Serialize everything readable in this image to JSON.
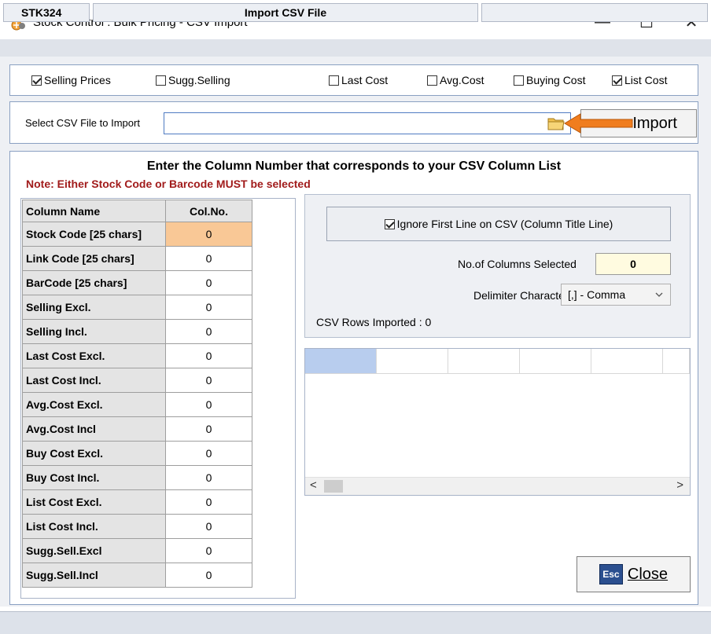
{
  "window": {
    "title": "Stock Control : Bulk Pricing - CSV Import",
    "minimize": "—",
    "maximize": "☐",
    "close": "✕"
  },
  "price_types": [
    {
      "label": "Selling Prices",
      "checked": true
    },
    {
      "label": "Sugg.Selling",
      "checked": false
    },
    {
      "label": "Last Cost",
      "checked": false
    },
    {
      "label": "Avg.Cost",
      "checked": false
    },
    {
      "label": "Buying Cost",
      "checked": false
    },
    {
      "label": "List Cost",
      "checked": true
    }
  ],
  "file": {
    "label": "Select CSV File to Import",
    "value": "",
    "import_label": "Import"
  },
  "mapping": {
    "heading": "Enter the Column Number that corresponds to your CSV Column List",
    "note": "Note: Either Stock Code or Barcode MUST be selected",
    "col_header_name": "Column Name",
    "col_header_num": "Col.No.",
    "rows": [
      {
        "name": "Stock Code [25 chars]",
        "value": "0"
      },
      {
        "name": "Link Code  [25 chars]",
        "value": "0"
      },
      {
        "name": "BarCode  [25 chars]",
        "value": "0"
      },
      {
        "name": "Selling Excl.",
        "value": "0"
      },
      {
        "name": "Selling Incl.",
        "value": "0"
      },
      {
        "name": "Last Cost Excl.",
        "value": "0"
      },
      {
        "name": "Last Cost Incl.",
        "value": "0"
      },
      {
        "name": "Avg.Cost Excl.",
        "value": "0"
      },
      {
        "name": "Avg.Cost Incl",
        "value": "0"
      },
      {
        "name": "Buy Cost Excl.",
        "value": "0"
      },
      {
        "name": "Buy Cost Incl.",
        "value": "0"
      },
      {
        "name": "List Cost Excl.",
        "value": "0"
      },
      {
        "name": "List Cost Incl.",
        "value": "0"
      },
      {
        "name": "Sugg.Sell.Excl",
        "value": "0"
      },
      {
        "name": "Sugg.Sell.Incl",
        "value": "0"
      }
    ]
  },
  "options": {
    "ignore_first_line": {
      "label": "Ignore First Line on CSV (Column Title Line)",
      "checked": true
    },
    "columns_selected_label": "No.of Columns Selected",
    "columns_selected_value": "0",
    "delimiter_label": "Delimiter Character",
    "delimiter_value": "[,] - Comma",
    "rows_imported": "CSV Rows Imported : 0"
  },
  "grid": {
    "scroll_left": "<",
    "scroll_right": ">"
  },
  "close_button": {
    "esc_label": "Esc",
    "label": "Close"
  },
  "status_bar": {
    "code": "STK324",
    "action": "Import CSV File"
  },
  "colors": {
    "accent_border": "#4f7bc2",
    "highlight_cell": "#f9c896",
    "note_red": "#a11b1b",
    "arrow_orange": "#f07d1e"
  }
}
